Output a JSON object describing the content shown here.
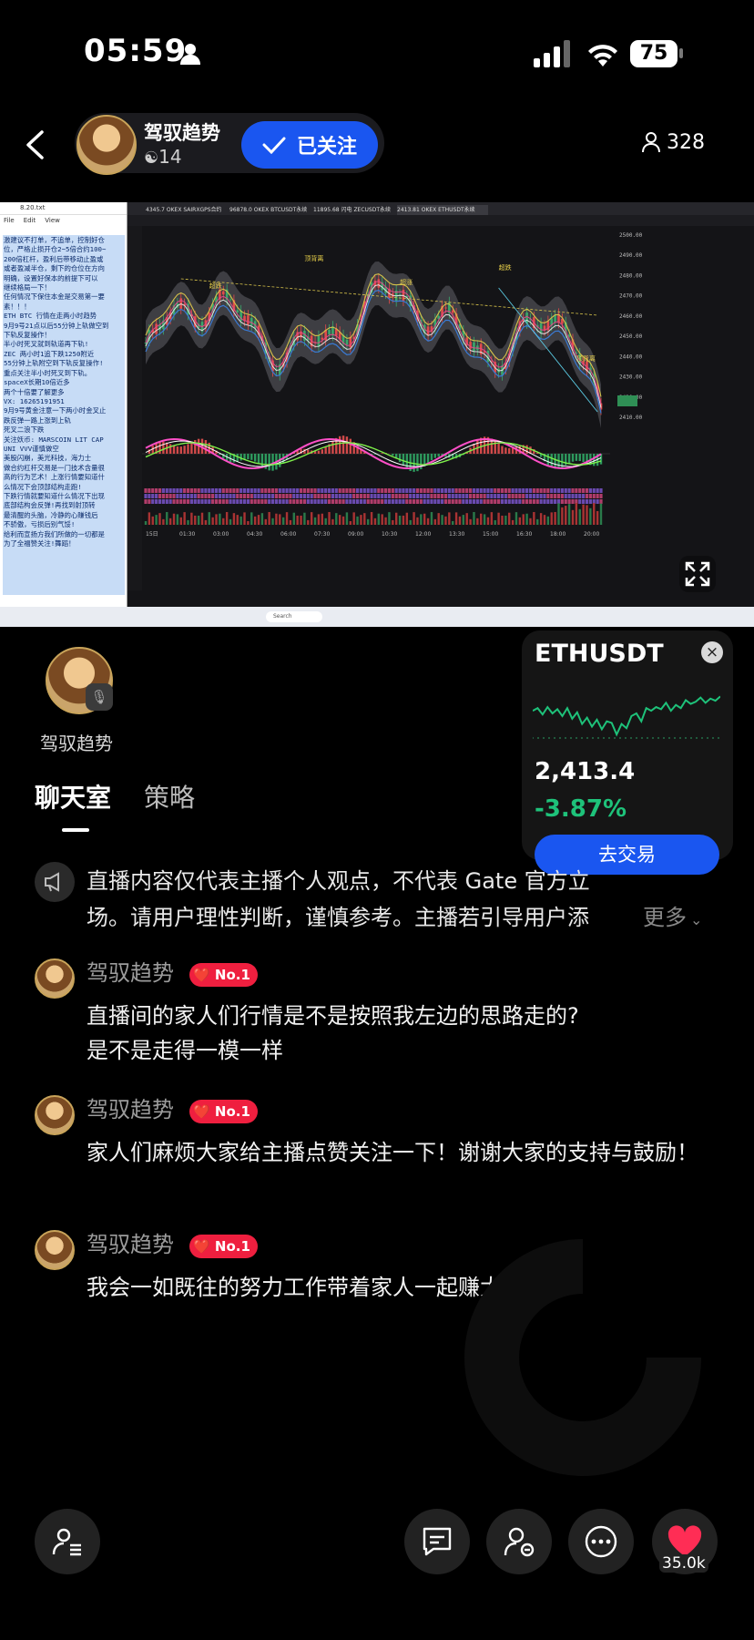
{
  "status_bar": {
    "time": "05:59",
    "battery": "75"
  },
  "header": {
    "host_name": "驾驭趋势",
    "host_fire": "14",
    "follow_label": "已关注",
    "viewer_count": "328"
  },
  "stream": {
    "notepad_title": "8.20.txt",
    "notepad_menu": [
      "File",
      "Edit",
      "View"
    ],
    "notepad_lines": [
      "激建议不打单，不追单，控制好仓",
      "位，严格止损开仓2~5倍合约100~",
      "200倍杠杆，盈利后带移动止盈或",
      "或者盈减半仓，剩下的仓位在方向",
      "明确，设置好保本的前提下可以",
      "继续格局一下！",
      "任何情况下保住本金是交易第一要",
      "素！！！",
      "ETH  BTC  行情在走两小时趋势",
      "9月9号21点以后55分钟上轨做空到",
      "下轨反复操作！",
      "半小时死叉就到轨道再下轨!",
      "ZEC  两小时1追下跌1250附近",
      "55分钟上轨附空到下轨反复操作!",
      "重点关注半小时死叉到下轨。",
      "spaceX长期10倍近多",
      "两个十倍要了解更多",
      "VX: 16265191951",
      "9月9号黄金注意一下两小时金叉止",
      "跌反弹一路上涨到上轨",
      "死叉二浪下跌",
      "关注妖币: MARSCOIN  LIT  CAP",
      "UNI  VVV谨慎做空",
      "美股闪崩，美光科技，海力士",
      "做合约杠杆交易是一门技术含量很",
      "高的行为艺术！上涨行情要知道什",
      "么情况下会顶部结构走跑!",
      "下跌行情就要知道什么情况下出现",
      "底部结构会反弹!再找到射顶转",
      "最清醒的头脑，冷静的心赚钱后",
      "不骄傲，亏损后别气馁!",
      "给利而宣扬方我们所做的一切都是",
      "为了全福赞关注!舞蹈！"
    ],
    "chart_tabs": [
      "4345.7 OKEX SAIRXGPS合约",
      "96878.0 OKEX BTCUSDT永续",
      "11895.68 闪电 ZECUSDT永续",
      "2413.81 OKEX ETHUSDT永续"
    ],
    "signals": [
      "超跌",
      "顶背离",
      "超涨"
    ],
    "taskbar_search": "Search",
    "chart_time_labels": [
      "15日",
      "01:30",
      "03:00",
      "04:30",
      "06:00",
      "07:30",
      "09:00",
      "10:30",
      "12:00",
      "13:30",
      "15:00",
      "16:30",
      "18:00",
      "20:00"
    ],
    "chart_price_labels": [
      "2500.00",
      "2490.00",
      "2480.00",
      "2470.00",
      "2460.00",
      "2450.00",
      "2440.00",
      "2430.00",
      "2420.00",
      "2410.00"
    ]
  },
  "eth_card": {
    "symbol": "ETHUSDT",
    "price": "2,413.4",
    "change": "-3.87%",
    "trade_label": "去交易",
    "spark": [
      0.55,
      0.6,
      0.48,
      0.62,
      0.5,
      0.58,
      0.45,
      0.6,
      0.4,
      0.52,
      0.3,
      0.42,
      0.25,
      0.38,
      0.2,
      0.35,
      0.32,
      0.1,
      0.3,
      0.22,
      0.45,
      0.5,
      0.35,
      0.6,
      0.55,
      0.62,
      0.58,
      0.7,
      0.55,
      0.66,
      0.6,
      0.75,
      0.68,
      0.72,
      0.8,
      0.7,
      0.78,
      0.74,
      0.82
    ]
  },
  "host_section": {
    "name": "驾驭趋势"
  },
  "tabs": {
    "chat": "聊天室",
    "strategy": "策略"
  },
  "notice": {
    "line1": "直播内容仅代表主播个人观点，不代表 Gate 官方立",
    "line2": "场。请用户理性判断，谨慎参考。主播若引导用户添",
    "more": "更多"
  },
  "messages": [
    {
      "name": "驾驭趋势",
      "badge": "No.1",
      "text": "直播间的家人们行情是不是按照我左边的思路走的?\n是不是走得一模一样"
    },
    {
      "name": "驾驭趋势",
      "badge": "No.1",
      "text": "家人们麻烦大家给主播点赞关注一下！谢谢大家的支持与鼓励！"
    },
    {
      "name": "驾驭趋势",
      "badge": "No.1",
      "text": "我会一如既往的努力工作带着家人一起赚大钱！"
    }
  ],
  "bottom_bar": {
    "like_count": "35.0k"
  },
  "colors": {
    "accent_blue": "#1a56f0",
    "positive_green": "#1ec27a",
    "like_red": "#ff2d55",
    "badge_red": "#ef1f3f"
  }
}
